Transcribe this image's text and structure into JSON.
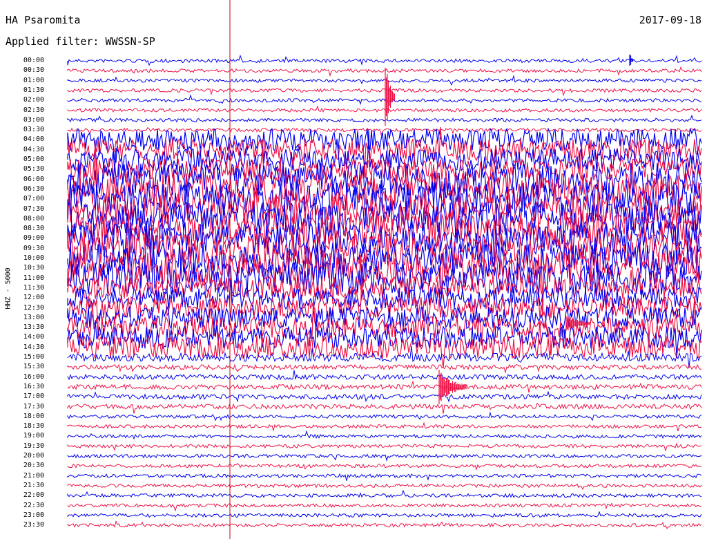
{
  "header": {
    "station": "HA Psaromita",
    "filter": "Applied filter: WWSSN-SP",
    "date": "2017-09-18",
    "channel": "HHZ - 5000"
  },
  "colors": {
    "odd_row": "#0000ee",
    "even_row": "#ee1144",
    "marker": "#cc0000"
  },
  "time_labels": [
    "00:00",
    "00:30",
    "01:00",
    "01:30",
    "02:00",
    "02:30",
    "03:00",
    "03:30",
    "04:00",
    "04:30",
    "05:00",
    "05:30",
    "06:00",
    "06:30",
    "07:00",
    "07:30",
    "08:00",
    "08:30",
    "09:00",
    "09:30",
    "10:00",
    "10:30",
    "11:00",
    "11:30",
    "12:00",
    "12:30",
    "13:00",
    "13:30",
    "14:00",
    "14:30",
    "15:00",
    "15:30",
    "16:00",
    "16:30",
    "17:00",
    "17:30",
    "18:00",
    "18:30",
    "19:00",
    "19:30",
    "20:00",
    "20:30",
    "21:00",
    "21:30",
    "22:00",
    "22:30",
    "23:00",
    "23:30"
  ]
}
